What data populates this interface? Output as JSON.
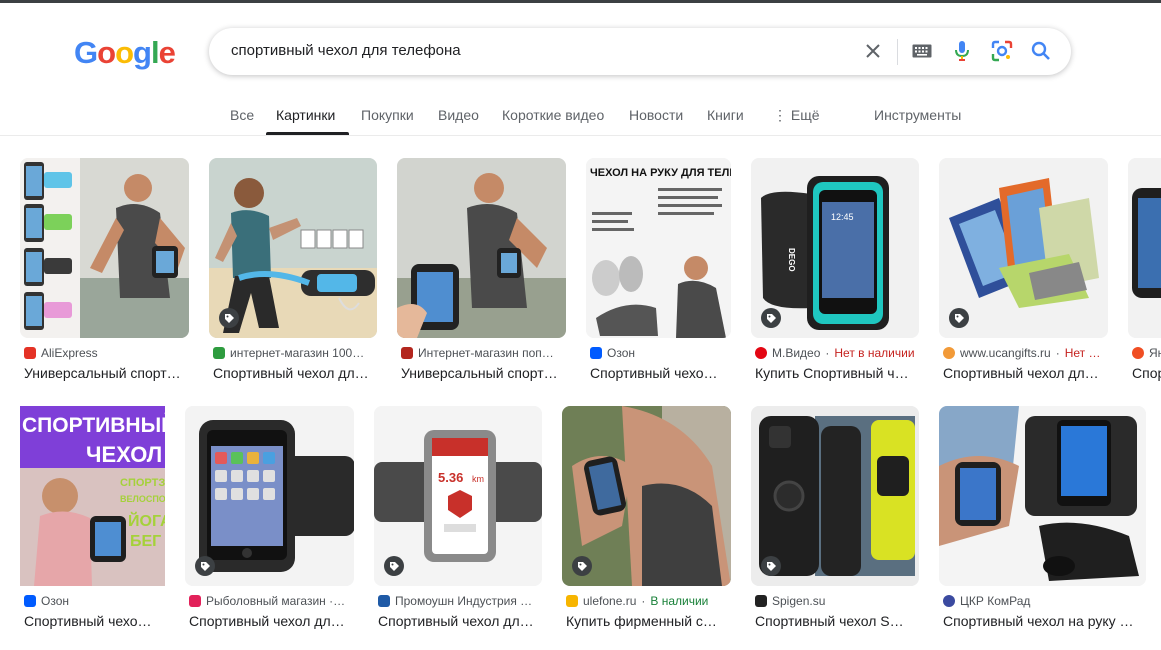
{
  "logo": {
    "letters": [
      "G",
      "o",
      "o",
      "g",
      "l",
      "e"
    ],
    "colors": [
      "#4285F4",
      "#EA4335",
      "#FBBC05",
      "#4285F4",
      "#34A853",
      "#EA4335"
    ]
  },
  "search": {
    "query": "спортивный чехол для телефона"
  },
  "icons": {
    "clear": "close-icon",
    "keyboard": "keyboard-icon",
    "voice": "microphone-icon",
    "lens": "camera-lens-icon",
    "search": "search-icon"
  },
  "tabs": [
    {
      "label": "Все"
    },
    {
      "label": "Картинки",
      "active": true
    },
    {
      "label": "Покупки"
    },
    {
      "label": "Видео"
    },
    {
      "label": "Короткие видео"
    },
    {
      "label": "Новости"
    },
    {
      "label": "Книги"
    },
    {
      "label": "⋮ Ещё"
    }
  ],
  "tools_label": "Инструменты",
  "results": [
    {
      "source": "AliExpress",
      "stock": "",
      "title": "Универсальный спорт…",
      "fav_color": "#e43225"
    },
    {
      "source": "интернет-магазин 100…",
      "stock": "",
      "title": "Спортивный чехол дл…",
      "fav_color": "#2e9c3f"
    },
    {
      "source": "Интернет-магазин поп…",
      "stock": "",
      "title": "Универсальный спорт…",
      "fav_color": "#b3261e"
    },
    {
      "source": "Озон",
      "stock": "",
      "title": "Спортивный чехо…",
      "fav_color": "#005bff"
    },
    {
      "source": "М.Видео",
      "stock": "Нет в наличии",
      "title": "Купить Спортивный ч…",
      "fav_color": "#e30613"
    },
    {
      "source": "www.ucangifts.ru",
      "stock": "Нет …",
      "title": "Спортивный чехол дл…",
      "fav_color": "#f29a38"
    },
    {
      "source": "Ян…",
      "stock": "",
      "title": "Спор…",
      "fav_color": "#f04e23"
    },
    {
      "source": "Озон",
      "stock": "",
      "title": "Спортивный чехо…",
      "fav_color": "#005bff"
    },
    {
      "source": "Рыболовный магазин ·…",
      "stock": "",
      "title": "Спортивный чехол дл…",
      "fav_color": "#e2215a"
    },
    {
      "source": "Промоушн Индустрия …",
      "stock": "",
      "title": "Спортивный чехол дл…",
      "fav_color": "#1f5aa6"
    },
    {
      "source": "ulefone.ru",
      "stock": "В наличии",
      "stock_green": true,
      "title": "Купить фирменный с…",
      "fav_color": "#f7b500"
    },
    {
      "source": "Spigen.su",
      "stock": "",
      "title": "Спортивный чехол S…",
      "fav_color": "#222222"
    },
    {
      "source": "ЦКР КомРад",
      "stock": "",
      "title": "Спортивный чехол на руку …",
      "fav_color": "#3b4aa0"
    }
  ],
  "thumb_texts": {
    "r1c4_heading": "ЧЕХОЛ НА РУКУ ДЛЯ ТЕЛЕФОНА",
    "r1c5_brand": "DEGO",
    "r1c5_time": "12:45",
    "r2c1_line1": "СПОРТИВНЫЙ",
    "r2c1_line2": "ЧЕХОЛ",
    "r2c1_side1": "СПОРТЗАЛ",
    "r2c1_side2": "ВЕЛОСПОРТ",
    "r2c1_side3": "ЙОГА",
    "r2c1_side4": "БЕГ",
    "r2c3_distance": "5.36",
    "r2c3_unit": "km"
  }
}
